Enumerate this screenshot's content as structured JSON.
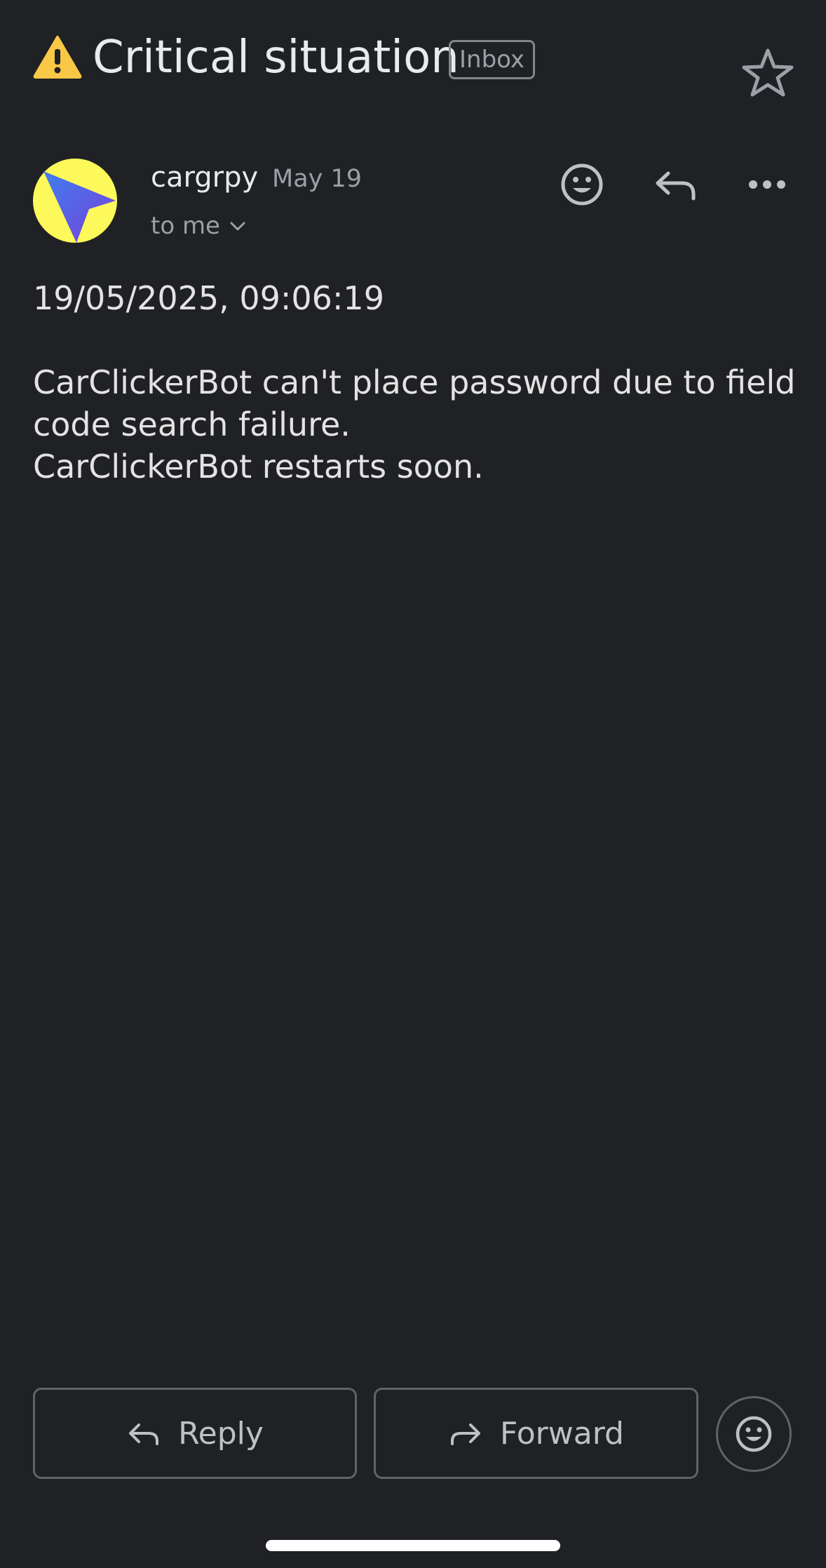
{
  "email": {
    "subject": "Critical situation",
    "label": "Inbox",
    "sender": {
      "name": "cargrpy",
      "date": "May 19",
      "recipient": "to me"
    },
    "body": {
      "timestamp": "19/05/2025, 09:06:19",
      "lines": [
        "CarClickerBot can't place password due to field\ncode search failure.",
        "CarClickerBot restarts soon."
      ]
    }
  },
  "actions": {
    "reply_label": "Reply",
    "forward_label": "Forward"
  },
  "icons": {
    "subject_icon": "warning-icon",
    "star": "star-icon",
    "react": "emoji-icon",
    "reply": "reply-icon",
    "more": "more-horizontal-icon"
  },
  "colors": {
    "background": "#202124",
    "avatar_bg": "#fdf95a",
    "warning": "#f9c846"
  }
}
